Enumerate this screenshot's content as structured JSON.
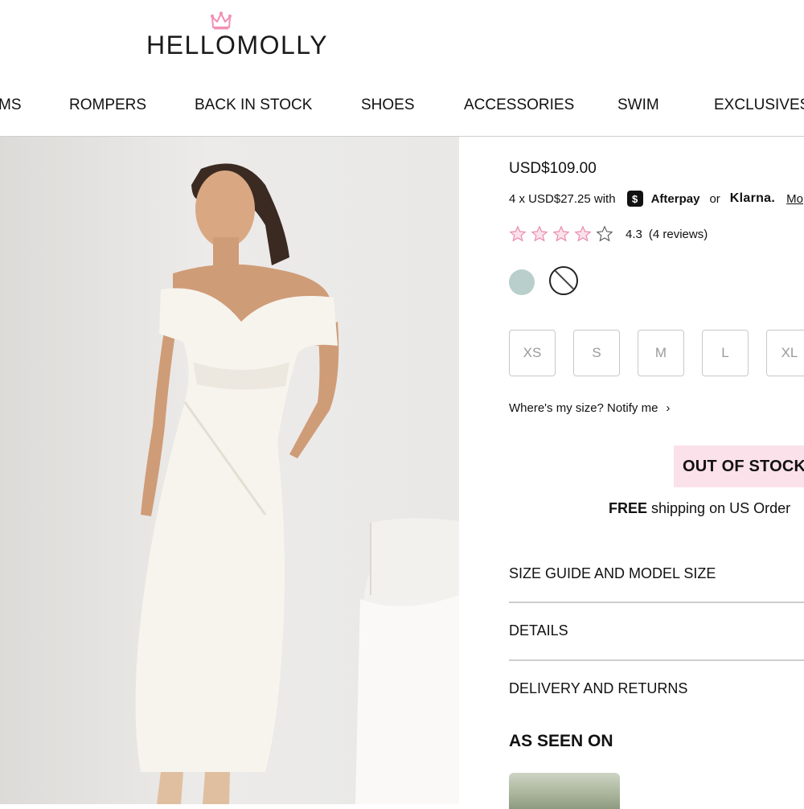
{
  "brand": {
    "name": "HELLOMOLLY",
    "crown_color": "#f28fb5"
  },
  "nav": {
    "items": [
      "MS",
      "ROMPERS",
      "BACK IN STOCK",
      "SHOES",
      "ACCESSORIES",
      "SWIM",
      "EXCLUSIVES"
    ]
  },
  "product": {
    "price": "USD$109.00",
    "installments": {
      "prefix": "4 x USD$27.25 with",
      "afterpay_symbol": "$",
      "afterpay": "Afterpay",
      "or": "or",
      "klarna": "Klarna.",
      "more": "Mo"
    },
    "rating": {
      "value": "4.3",
      "count": "(4 reviews)",
      "stars_filled": 4,
      "stars_total": 5,
      "star_color": "#f6a6c6"
    },
    "colors": [
      {
        "name": "mint",
        "hex": "#b8cfcc"
      },
      {
        "name": "white",
        "hex": "#ffffff",
        "selected": true
      }
    ],
    "sizes": [
      "XS",
      "S",
      "M",
      "L",
      "XL"
    ],
    "notify": "Where's my size? Notify me",
    "status": "OUT OF STOCK",
    "shipping": {
      "bold": "FREE",
      "rest": " shipping on US Order"
    },
    "accordions": [
      "SIZE GUIDE AND MODEL SIZE",
      "DETAILS",
      "DELIVERY AND RETURNS"
    ],
    "as_seen_on": "AS SEEN ON"
  },
  "colors": {
    "oos_bg": "#fbe1ea",
    "accent_pink": "#f28fb5"
  }
}
